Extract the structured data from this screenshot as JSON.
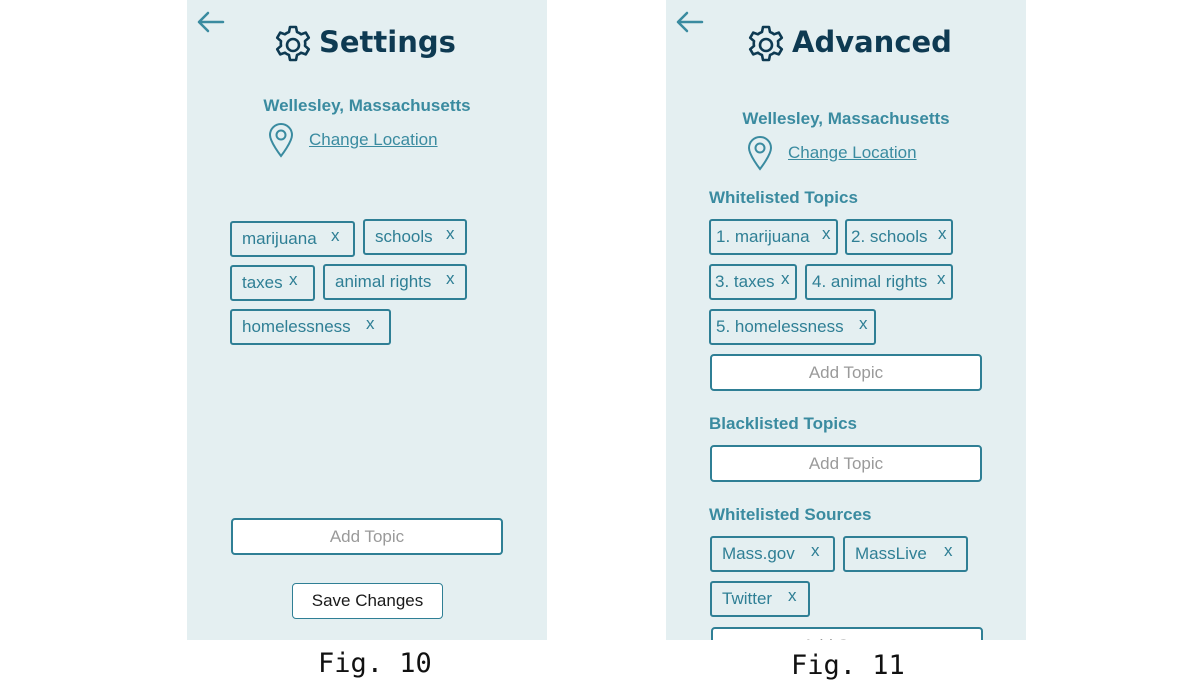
{
  "fig10": {
    "caption": "Fig. 10",
    "title": "Settings",
    "location": "Wellesley, Massachusetts",
    "change_location": "Change Location",
    "topics": [
      {
        "label": "marijuana",
        "remove": "x"
      },
      {
        "label": "schools",
        "remove": "x"
      },
      {
        "label": "taxes",
        "remove": "x"
      },
      {
        "label": "animal rights",
        "remove": "x"
      },
      {
        "label": "homelessness",
        "remove": "x"
      }
    ],
    "add_topic_placeholder": "Add Topic",
    "save_label": "Save Changes"
  },
  "fig11": {
    "caption": "Fig. 11",
    "title": "Advanced",
    "location": "Wellesley, Massachusetts",
    "change_location": "Change Location",
    "whitelisted_topics_label": "Whitelisted Topics",
    "whitelisted_topics": [
      {
        "label": "1. marijuana",
        "remove": "x"
      },
      {
        "label": "2. schools",
        "remove": "x"
      },
      {
        "label": "3. taxes",
        "remove": "x"
      },
      {
        "label": "4. animal rights",
        "remove": "x"
      },
      {
        "label": "5. homelessness",
        "remove": "x"
      }
    ],
    "add_topic_placeholder": "Add Topic",
    "blacklisted_topics_label": "Blacklisted Topics",
    "blacklist_add_placeholder": "Add Topic",
    "whitelisted_sources_label": "Whitelisted Sources",
    "whitelisted_sources": [
      {
        "label": "Mass.gov",
        "remove": "x"
      },
      {
        "label": "MassLive",
        "remove": "x"
      },
      {
        "label": "Twitter",
        "remove": "x"
      }
    ],
    "add_source_placeholder": "Add Source"
  },
  "colors": {
    "panel_bg": "#e4eff1",
    "accent": "#2f7f95",
    "heading": "#0e3a52",
    "label": "#3a8ba0"
  },
  "icons": [
    "back-arrow-icon",
    "gear-icon",
    "location-pin-icon",
    "remove-x-icon"
  ]
}
